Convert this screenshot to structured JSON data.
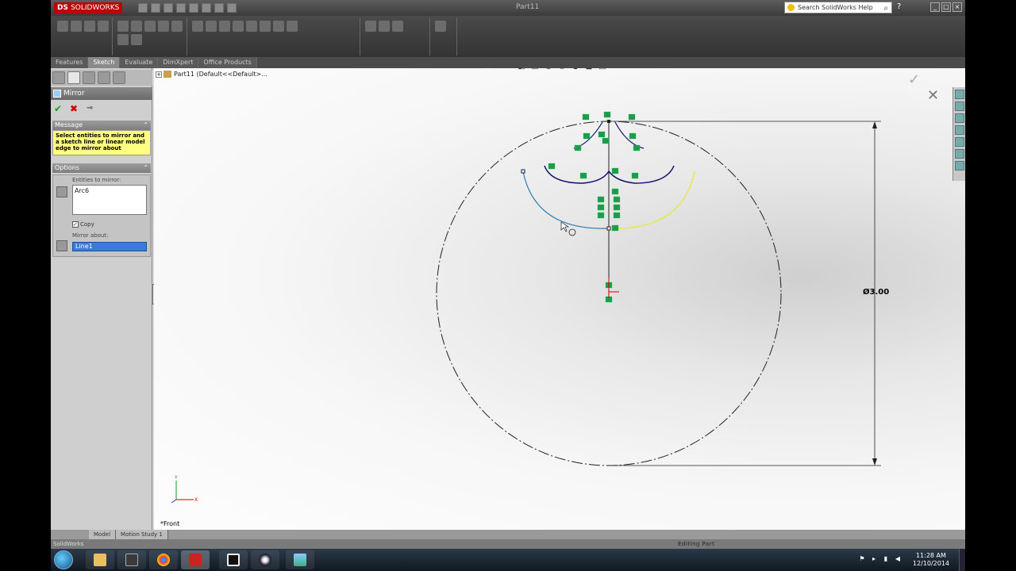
{
  "app": {
    "logo_brand": "SOLIDWORKS",
    "doc_title": "Part11",
    "search_placeholder": "Search SolidWorks Help",
    "help_label": "?",
    "window_controls": [
      "_",
      "□",
      "×"
    ]
  },
  "command_tabs": [
    {
      "label": "Features",
      "active": false
    },
    {
      "label": "Sketch",
      "active": true
    },
    {
      "label": "Evaluate",
      "active": false
    },
    {
      "label": "DimXpert",
      "active": false
    },
    {
      "label": "Office Products",
      "active": false
    }
  ],
  "property_manager": {
    "title": "Mirror",
    "ok_icon": "check-icon",
    "cancel_icon": "close-icon",
    "pin_icon": "pushpin-icon",
    "message_section": "Message",
    "message_text": "Select entities to mirror and a sketch line or linear model edge to mirror about",
    "options_section": "Options",
    "entities_label": "Entities to mirror:",
    "entities_list": [
      "Arc6"
    ],
    "copy_label": "Copy",
    "copy_checked": true,
    "mirror_about_label": "Mirror about:",
    "mirror_about_value": "Line1"
  },
  "graphics": {
    "tree_crumb": "Part11  (Default<<Default>...",
    "dimension_text": "Ø3.00",
    "view_name": "*Front",
    "accent_colors": {
      "arc_selected": "#2f7fb0",
      "arc_mirror_preview": "#e8e84a",
      "sketch_geometry": "#10106b",
      "relation_marker": "#1f9b4c"
    }
  },
  "bottom_tabs": [
    {
      "label": "Model",
      "active": true
    },
    {
      "label": "Motion Study 1",
      "active": false
    }
  ],
  "status": {
    "left": "SolidWorks",
    "right": "Editing Part"
  },
  "taskbar": {
    "apps": [
      "windows-explorer",
      "media-player",
      "chrome",
      "solidworks",
      "tablet",
      "media-center",
      "image-viewer"
    ],
    "clock_time": "11:28 AM",
    "clock_date": "12/10/2014"
  }
}
